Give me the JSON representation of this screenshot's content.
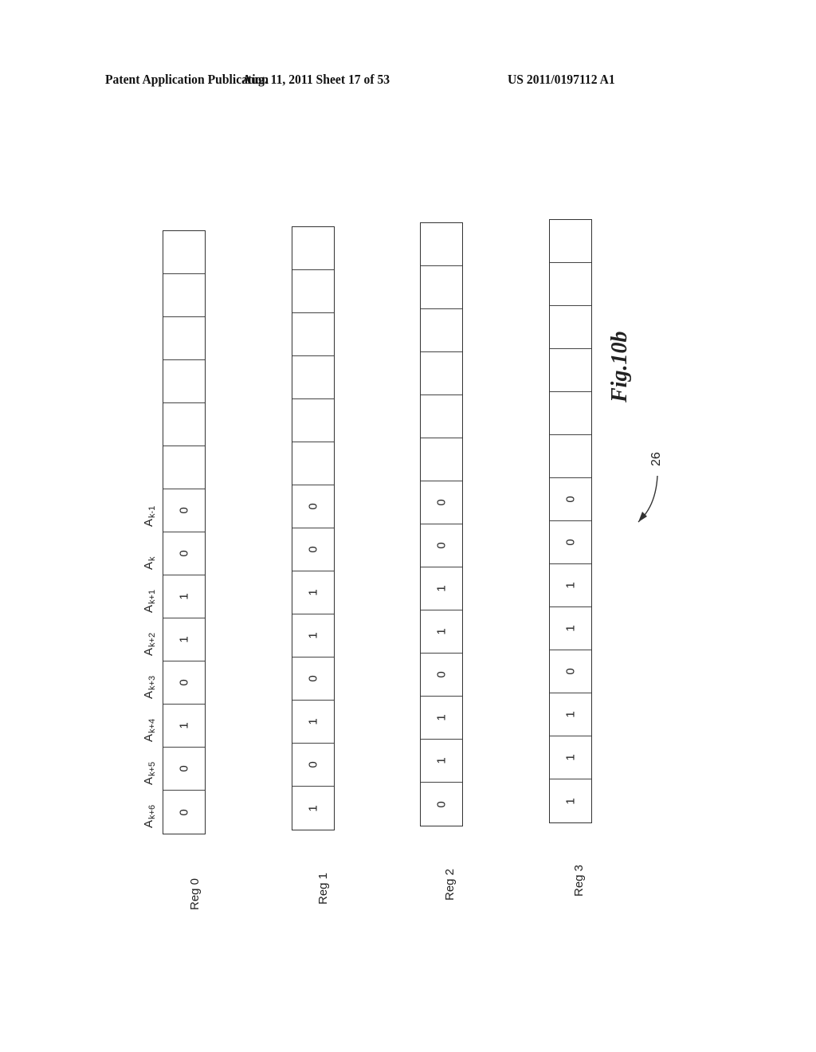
{
  "header": {
    "publication": "Patent Application Publication",
    "date_sheet": "Aug. 11, 2011  Sheet 17 of 53",
    "number": "US 2011/0197112 A1"
  },
  "figure": {
    "label": "Fig.10b",
    "reference_numeral": "26"
  },
  "column_labels": [
    {
      "base": "A",
      "sub": "k-1"
    },
    {
      "base": "A",
      "sub": "k"
    },
    {
      "base": "A",
      "sub": "k+1"
    },
    {
      "base": "A",
      "sub": "k+2"
    },
    {
      "base": "A",
      "sub": "k+3"
    },
    {
      "base": "A",
      "sub": "k+4"
    },
    {
      "base": "A",
      "sub": "k+5"
    },
    {
      "base": "A",
      "sub": "k+6"
    }
  ],
  "empty_cells_per_register": 6,
  "registers": [
    {
      "label": "Reg 0",
      "bits": [
        "0",
        "0",
        "1",
        "1",
        "0",
        "1",
        "0",
        "0"
      ]
    },
    {
      "label": "Reg 1",
      "bits": [
        "0",
        "0",
        "1",
        "1",
        "0",
        "1",
        "0",
        "1"
      ]
    },
    {
      "label": "Reg 2",
      "bits": [
        "0",
        "0",
        "1",
        "1",
        "0",
        "1",
        "1",
        "0"
      ]
    },
    {
      "label": "Reg 3",
      "bits": [
        "0",
        "0",
        "1",
        "1",
        "0",
        "1",
        "1",
        "1"
      ]
    }
  ]
}
